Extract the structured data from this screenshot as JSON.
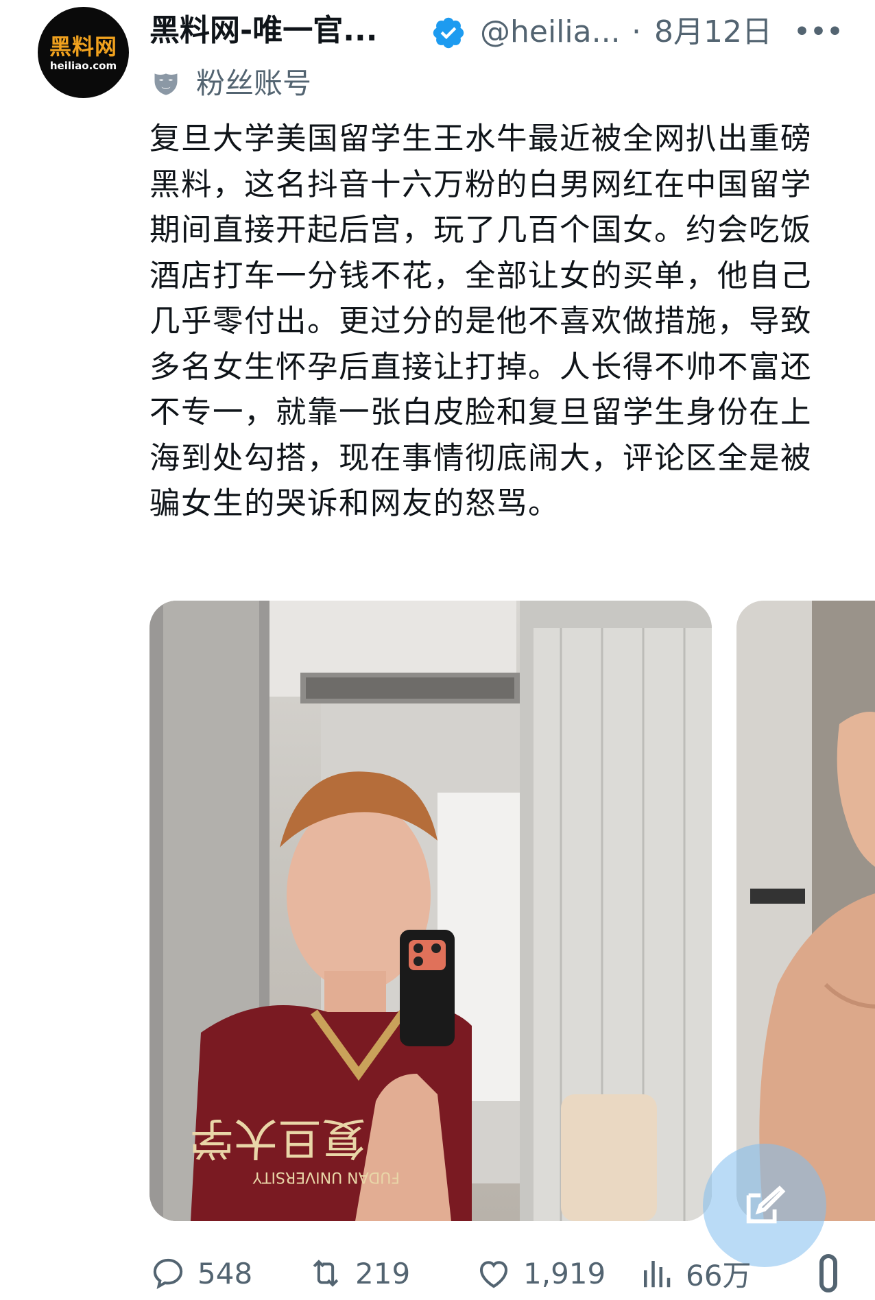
{
  "post": {
    "author": {
      "avatar_logo": "黑料网",
      "avatar_domain": "heiliao.com",
      "display_name": "黑料网-唯一官...",
      "handle": "@heilia...",
      "date": "8月12日"
    },
    "account_label": "粉丝账号",
    "text": "复旦大学美国留学生王水牛最近被全网扒出重磅黑料，这名抖音十六万粉的白男网红在中国留学期间直接开起后宫，玩了几百个国女。约会吃饭酒店打车一分钱不花，全部让女的买单，他自己几乎零付出。更过分的是他不喜欢做措施，导致多名女生怀孕后直接让打掉。人长得不帅不富还不专一，就靠一张白皮脸和复旦留学生身份在上海到处勾搭，现在事情彻底闹大，评论区全是被骗女生的哭诉和网友的怒骂。",
    "media": {
      "jersey_text": "复旦大学",
      "jersey_subtext": "FUDAN UNIVERSITY"
    },
    "stats": {
      "replies": "548",
      "reposts": "219",
      "likes": "1,919",
      "views": "66万"
    }
  },
  "icons": {
    "verified": "verified-badge-icon",
    "more": "more-icon",
    "mask": "mask-icon",
    "reply": "reply-icon",
    "repost": "repost-icon",
    "like": "like-icon",
    "views": "views-icon",
    "compose": "compose-icon",
    "share": "share-icon"
  },
  "colors": {
    "text_primary": "#0f1419",
    "text_secondary": "#536471",
    "verified_blue": "#1d9bf0",
    "logo_orange": "#f0a11e",
    "fab_blue": "#82beee"
  }
}
